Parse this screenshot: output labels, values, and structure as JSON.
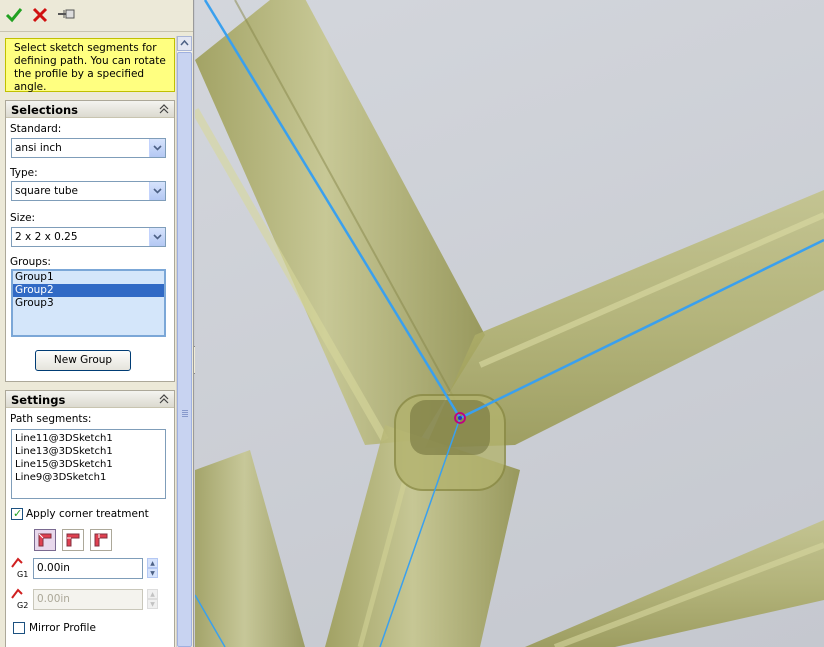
{
  "toolbar": {
    "ok_icon": "check-icon",
    "cancel_icon": "x-icon",
    "pin_icon": "pushpin-icon"
  },
  "message": {
    "text": "Select sketch segments for defining path. You can rotate the profile by a specified angle."
  },
  "selections": {
    "header": "Selections",
    "standard_label": "Standard:",
    "standard_value": "ansi inch",
    "type_label": "Type:",
    "type_value": "square tube",
    "size_label": "Size:",
    "size_value": "2 x 2 x 0.25",
    "groups_label": "Groups:",
    "groups": [
      "Group1",
      "Group2",
      "Group3"
    ],
    "selected_group": "Group2",
    "new_group_button": "New Group"
  },
  "settings": {
    "header": "Settings",
    "path_segments_label": "Path segments:",
    "path_segments": [
      "Line11@3DSketch1",
      "Line13@3DSketch1",
      "Line15@3DSketch1",
      "Line9@3DSketch1"
    ],
    "corner_treatment_label": "Apply corner treatment",
    "corner_treatment_checked": true,
    "gap1_label": "G1",
    "gap1_value": "0.00in",
    "gap2_label": "G2",
    "gap2_value": "0.00in",
    "mirror_label": "Mirror Profile",
    "mirror_checked": false
  },
  "colors": {
    "accent": "#316ac5",
    "message_bg": "#ffff80",
    "tube": "#a8a85a",
    "sketch_line": "#3aa0ee"
  }
}
